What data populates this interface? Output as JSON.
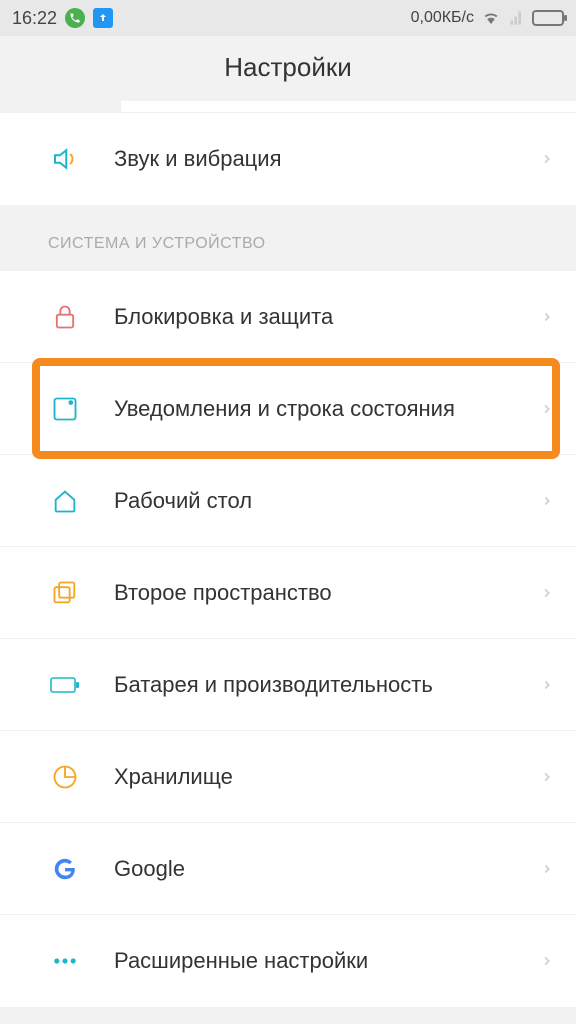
{
  "status": {
    "time": "16:22",
    "data_rate": "0,00КБ/с"
  },
  "header": {
    "title": "Настройки"
  },
  "items": {
    "sound": "Звук и вибрация",
    "section_system": "СИСТЕМА И УСТРОЙСТВО",
    "lock": "Блокировка и защита",
    "notifications": "Уведомления и строка состояния",
    "home": "Рабочий стол",
    "second_space": "Второе пространство",
    "battery": "Батарея и производительность",
    "storage": "Хранилище",
    "google": "Google",
    "advanced": "Расширенные настройки"
  }
}
